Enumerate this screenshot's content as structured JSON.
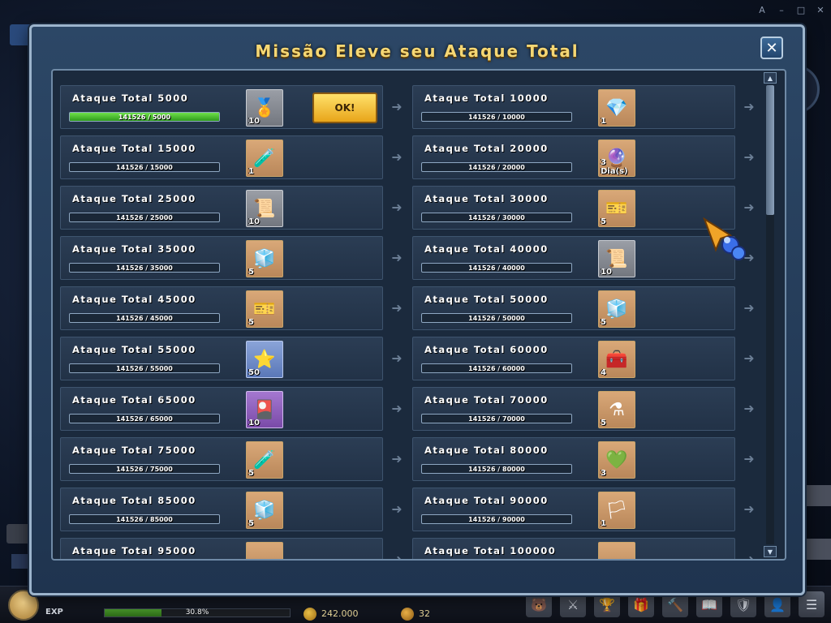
{
  "window": {
    "controls": [
      "A",
      "–",
      "□",
      "✕"
    ]
  },
  "modal": {
    "title": "Missão Eleve seu Ataque Total",
    "close_label": "✕",
    "ok_label": "OK!",
    "arrow_glyph": "➜"
  },
  "progress_current": 141526,
  "rows": [
    {
      "left": {
        "title": "Ataque Total 5000",
        "progress_text": "141526 / 5000",
        "progress_fraction": 1.0,
        "completed": true,
        "reward_icon": "medal-icon",
        "reward_glyph": "🏅",
        "reward_count": "10",
        "reward_bg": "gray"
      },
      "right": {
        "title": "Ataque Total 10000",
        "progress_text": "141526 / 10000",
        "progress_fraction": 0,
        "reward_icon": "winged-gem-icon",
        "reward_glyph": "💎",
        "reward_count": "1",
        "reward_bg": "tan"
      }
    },
    {
      "left": {
        "title": "Ataque Total 15000",
        "progress_text": "141526 / 15000",
        "progress_fraction": 0,
        "reward_icon": "potion-icon",
        "reward_glyph": "🧪",
        "reward_count": "1",
        "reward_bg": "tan"
      },
      "right": {
        "title": "Ataque Total 20000",
        "progress_text": "141526 / 20000",
        "progress_fraction": 0,
        "reward_icon": "orb-icon",
        "reward_glyph": "🔮",
        "reward_count": "3 Dia(s)",
        "reward_bg": "tan"
      }
    },
    {
      "left": {
        "title": "Ataque Total 25000",
        "progress_text": "141526 / 25000",
        "progress_fraction": 0,
        "reward_icon": "scroll-icon",
        "reward_glyph": "📜",
        "reward_count": "10",
        "reward_bg": "gray"
      },
      "right": {
        "title": "Ataque Total 30000",
        "progress_text": "141526 / 30000",
        "progress_fraction": 0,
        "reward_icon": "ticket-icon",
        "reward_glyph": "🎫",
        "reward_count": "5",
        "reward_bg": "tan"
      }
    },
    {
      "left": {
        "title": "Ataque Total 35000",
        "progress_text": "141526 / 35000",
        "progress_fraction": 0,
        "reward_icon": "crate-icon",
        "reward_glyph": "🧊",
        "reward_count": "5",
        "reward_bg": "tan"
      },
      "right": {
        "title": "Ataque Total 40000",
        "progress_text": "141526 / 40000",
        "progress_fraction": 0,
        "reward_icon": "scroll-icon",
        "reward_glyph": "📜",
        "reward_count": "10",
        "reward_bg": "gray"
      }
    },
    {
      "left": {
        "title": "Ataque Total 45000",
        "progress_text": "141526 / 45000",
        "progress_fraction": 0,
        "reward_icon": "ticket-icon",
        "reward_glyph": "🎫",
        "reward_count": "5",
        "reward_bg": "tan"
      },
      "right": {
        "title": "Ataque Total 50000",
        "progress_text": "141526 / 50000",
        "progress_fraction": 0,
        "reward_icon": "crate-icon",
        "reward_glyph": "🧊",
        "reward_count": "5",
        "reward_bg": "tan"
      }
    },
    {
      "left": {
        "title": "Ataque Total 55000",
        "progress_text": "141526 / 55000",
        "progress_fraction": 0,
        "reward_icon": "star-coin-icon",
        "reward_glyph": "⭐",
        "reward_count": "50",
        "reward_bg": "blue"
      },
      "right": {
        "title": "Ataque Total 60000",
        "progress_text": "141526 / 60000",
        "progress_fraction": 0,
        "reward_icon": "chest-icon",
        "reward_glyph": "🧰",
        "reward_count": "4",
        "reward_bg": "tan"
      }
    },
    {
      "left": {
        "title": "Ataque Total 65000",
        "progress_text": "141526 / 65000",
        "progress_fraction": 0,
        "reward_icon": "card-pack-icon",
        "reward_glyph": "🎴",
        "reward_count": "10",
        "reward_bg": "purple"
      },
      "right": {
        "title": "Ataque Total 70000",
        "progress_text": "141526 / 70000",
        "progress_fraction": 0,
        "reward_icon": "pink-potion-icon",
        "reward_glyph": "⚗",
        "reward_count": "5",
        "reward_bg": "tan"
      }
    },
    {
      "left": {
        "title": "Ataque Total 75000",
        "progress_text": "141526 / 75000",
        "progress_fraction": 0,
        "reward_icon": "blue-potion-icon",
        "reward_glyph": "🧪",
        "reward_count": "5",
        "reward_bg": "tan"
      },
      "right": {
        "title": "Ataque Total 80000",
        "progress_text": "141526 / 80000",
        "progress_fraction": 0,
        "reward_icon": "green-gem-icon",
        "reward_glyph": "💚",
        "reward_count": "3",
        "reward_bg": "tan"
      }
    },
    {
      "left": {
        "title": "Ataque Total 85000",
        "progress_text": "141526 / 85000",
        "progress_fraction": 0,
        "reward_icon": "crate-icon",
        "reward_glyph": "🧊",
        "reward_count": "5",
        "reward_bg": "tan"
      },
      "right": {
        "title": "Ataque Total 90000",
        "progress_text": "141526 / 90000",
        "progress_fraction": 0,
        "reward_icon": "banner-icon",
        "reward_glyph": "🏳",
        "reward_count": "1",
        "reward_bg": "tan"
      }
    },
    {
      "left": {
        "title": "Ataque Total 95000",
        "progress_text": "",
        "progress_fraction": 0,
        "reward_icon": "scroll-icon",
        "reward_glyph": "",
        "reward_count": "",
        "reward_bg": "tan"
      },
      "right": {
        "title": "Ataque Total 100000",
        "progress_text": "",
        "progress_fraction": 0,
        "reward_icon": "ticket-icon",
        "reward_glyph": "",
        "reward_count": "",
        "reward_bg": "tan"
      }
    }
  ],
  "scroll": {
    "position_fraction": 0.0,
    "up_glyph": "▲",
    "down_glyph": "▼"
  },
  "hud": {
    "exp_label": "EXP",
    "exp_percent_text": "30.8%",
    "exp_fraction": 0.308,
    "gold": "242.000",
    "cash": "32",
    "icons": [
      "bear-icon",
      "swords-icon",
      "rank-icon",
      "shop-icon",
      "gavel-icon",
      "book-icon",
      "guild-icon",
      "friend-icon",
      "menu-icon"
    ],
    "icon_glyphs": [
      "🐻",
      "⚔",
      "🏆",
      "🎁",
      "🔨",
      "📖",
      "🛡",
      "👤",
      "☰"
    ]
  },
  "colors": {
    "title_gold": "#f5d774",
    "ok_yellow": "#ffd34a",
    "progress_green": "#4fc02c",
    "frame_border": "#9cb4cc"
  }
}
